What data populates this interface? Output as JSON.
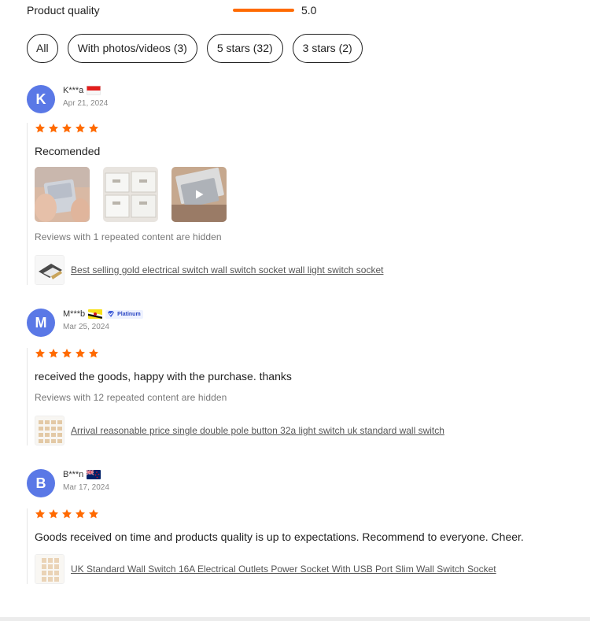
{
  "summary": {
    "product_quality_label": "Product quality",
    "product_quality_score": "5.0",
    "product_quality_fraction": 1.0
  },
  "filters": [
    {
      "label": "All",
      "selected": true
    },
    {
      "label": "With photos/videos (3)",
      "selected": false
    },
    {
      "label": "5 stars (32)",
      "selected": false
    },
    {
      "label": "3 stars (2)",
      "selected": false
    }
  ],
  "colors": {
    "star": "#ff6a00",
    "avatar": "#5a78e6",
    "rating_bar": "#ff6a00"
  },
  "reviews": [
    {
      "initial": "K",
      "username": "K***a",
      "flag": "indonesia-flag",
      "date": "Apr 21, 2024",
      "stars": 5,
      "text": "Recomended",
      "media": [
        {
          "kind": "photo",
          "icon": "boxed-switch-photo"
        },
        {
          "kind": "photo",
          "icon": "switch-boxes-photo"
        },
        {
          "kind": "video",
          "icon": "play-icon"
        }
      ],
      "hidden_note": "Reviews with 1 repeated content are hidden",
      "product": "Best selling gold electrical switch wall switch socket wall light switch socket"
    },
    {
      "initial": "M",
      "username": "M***b",
      "flag": "brunei-flag",
      "badge": "Platinum",
      "date": "Mar 25, 2024",
      "stars": 5,
      "text": "received the goods, happy with the purchase. thanks",
      "hidden_note": "Reviews with 12 repeated content are hidden",
      "product": "Arrival reasonable price single double pole button 32a light switch uk standard wall switch"
    },
    {
      "initial": "B",
      "username": "B***n",
      "flag": "new-zealand-flag",
      "date": "Mar 17, 2024",
      "stars": 5,
      "text": "Goods received on time and products quality is up to expectations. Recommend to everyone. Cheer.",
      "product": "UK Standard Wall Switch 16A Electrical Outlets Power Socket With USB Port Slim Wall Switch Socket"
    }
  ]
}
